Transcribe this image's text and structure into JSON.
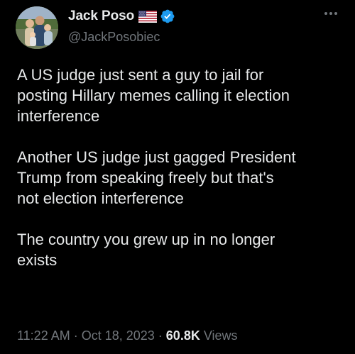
{
  "author": {
    "display_name": "Jack Poso",
    "handle": "@JackPosobiec",
    "flag_icon": "us-flag-icon",
    "verified_icon": "verified-badge-icon",
    "verified_color": "#1d9bf0"
  },
  "tweet": {
    "paragraphs": [
      "A US judge just sent a guy to jail for\nposting Hillary memes calling it election\ninterference",
      "Another US judge just gagged President\nTrump from speaking freely but that's\nnot election interference",
      "The country you grew up in no longer\nexists"
    ]
  },
  "meta": {
    "time": "11:22 AM",
    "separator": "·",
    "date": "Oct 18, 2023",
    "views_count": "60.8K",
    "views_label": "Views"
  },
  "colors": {
    "background": "#000000",
    "primary_text": "#e7e9ea",
    "secondary_text": "#71767b",
    "accent": "#1d9bf0"
  }
}
